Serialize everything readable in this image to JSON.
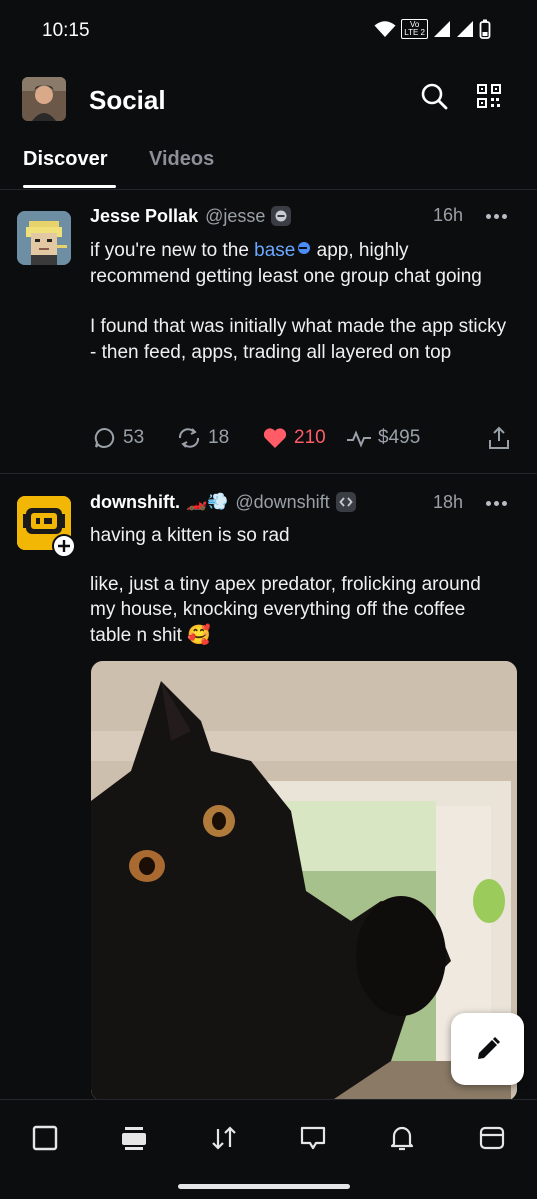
{
  "status_bar": {
    "time": "10:15",
    "network_label": "Vo LTE 2"
  },
  "header": {
    "title": "Social",
    "search_icon": "search-icon",
    "qr_icon": "qr-code-icon"
  },
  "tabs": [
    {
      "label": "Discover",
      "active": true
    },
    {
      "label": "Videos",
      "active": false
    }
  ],
  "posts": [
    {
      "author": "Jesse Pollak",
      "handle": "@jesse",
      "time": "16h",
      "text_before_link": "if you're new to the ",
      "link_text": "base",
      "text_after_link": " app, highly recommend getting least one group chat going",
      "paragraph_2": "I found that was initially what made the app sticky - then feed, apps, trading all layered on top",
      "replies": "53",
      "recasts": "18",
      "likes": "210",
      "tips": "$495"
    },
    {
      "author": "downshift.",
      "author_emoji": "🏎️💨",
      "handle": "@downshift",
      "time": "18h",
      "paragraph_1": "having a kitten is so rad",
      "paragraph_2": "like, just a tiny apex predator, frolicking around my house, knocking everything off the coffee table n shit 🥰"
    }
  ],
  "colors": {
    "accent_link": "#6aa8ff",
    "like": "#ff5c67",
    "background": "#0c0d0f"
  },
  "bottom_nav": [
    "home-icon",
    "feed-icon",
    "trade-icon",
    "messages-icon",
    "notifications-icon",
    "wallet-icon"
  ]
}
